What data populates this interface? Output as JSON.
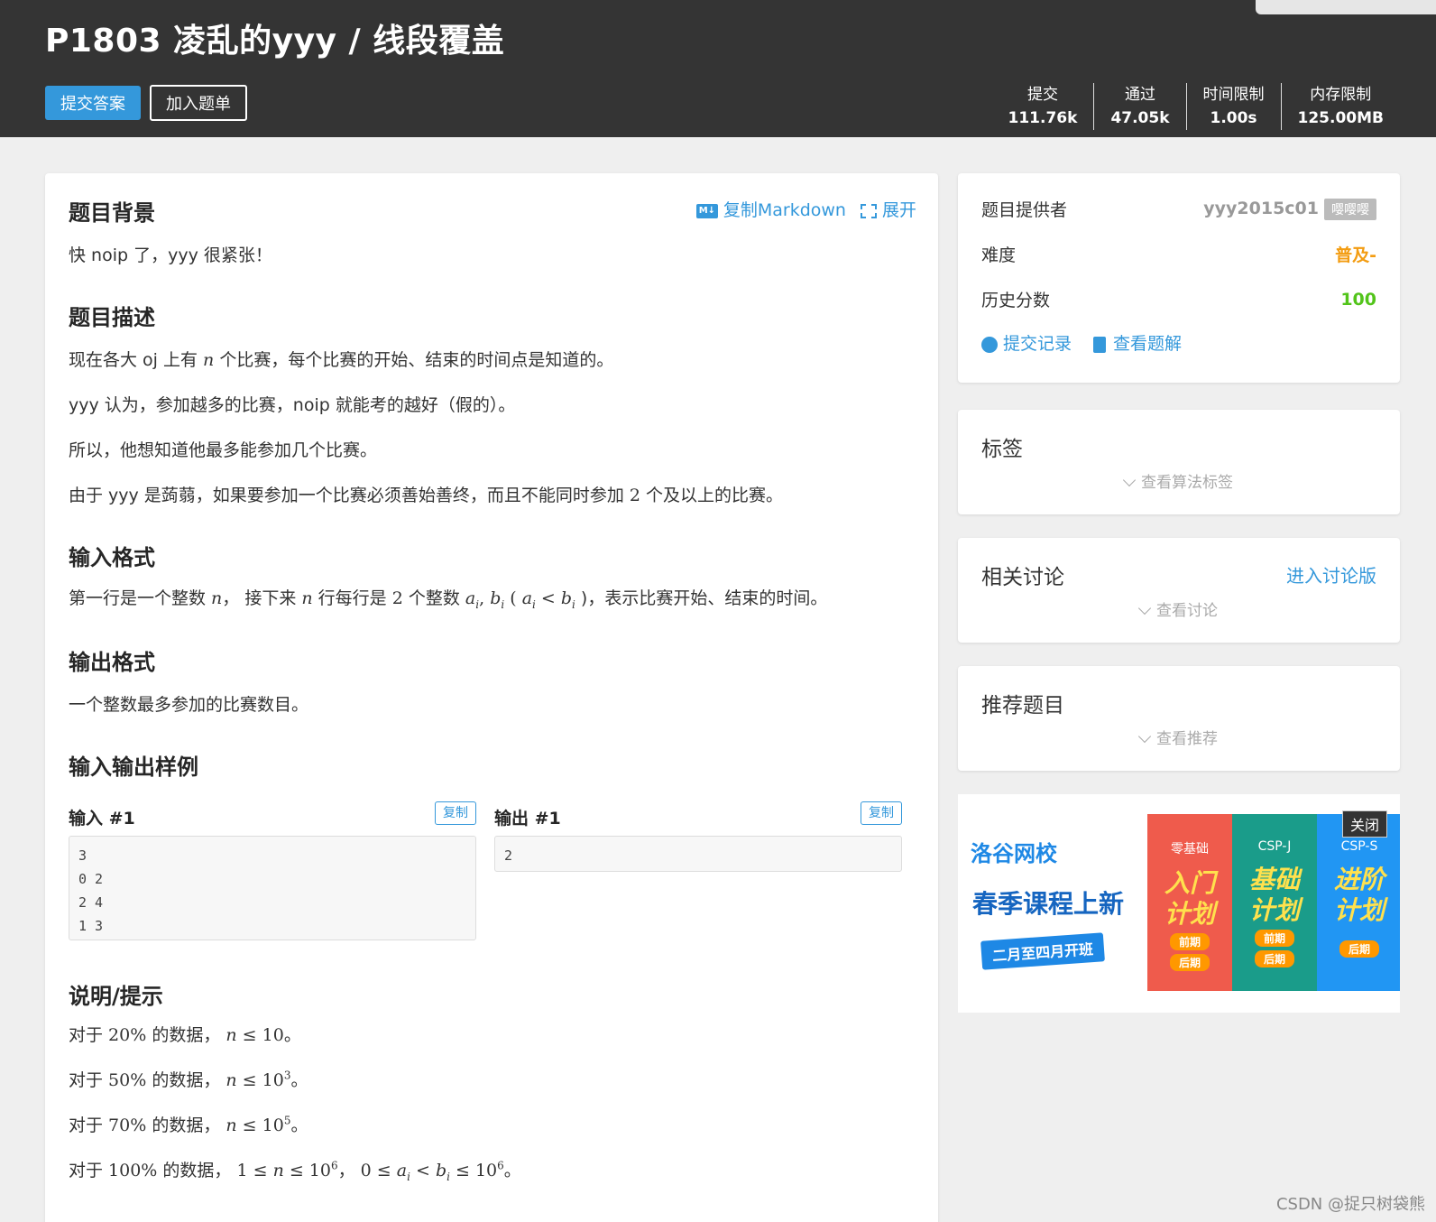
{
  "header": {
    "title": "P1803 凌乱的yyy / 线段覆盖",
    "submit_label": "提交答案",
    "add_label": "加入题单",
    "stats": [
      {
        "label": "提交",
        "value": "111.76k"
      },
      {
        "label": "通过",
        "value": "47.05k"
      },
      {
        "label": "时间限制",
        "value": "1.00s"
      },
      {
        "label": "内存限制",
        "value": "125.00MB"
      }
    ]
  },
  "main": {
    "tools": {
      "md_icon": "M↓",
      "copy_md": "复制Markdown",
      "expand": "展开"
    },
    "background": {
      "title": "题目背景",
      "text": "快 noip 了，yyy 很紧张！"
    },
    "description": {
      "title": "题目描述",
      "p1_a": "现在各大 oj 上有 ",
      "p1_var": "n",
      "p1_b": " 个比赛，每个比赛的开始、结束的时间点是知道的。",
      "p2": "yyy 认为，参加越多的比赛，noip 就能考的越好（假的）。",
      "p3": "所以，他想知道他最多能参加几个比赛。",
      "p4_a": "由于 yyy 是蒟蒻，如果要参加一个比赛必须善始善终，而且不能同时参加 ",
      "p4_num": "2",
      "p4_b": " 个及以上的比赛。"
    },
    "input_format": {
      "title": "输入格式",
      "a": "第一行是一个整数 ",
      "n1": "n",
      "b": "， 接下来 ",
      "n2": "n",
      "c": " 行每行是 ",
      "two": "2",
      "d": " 个整数 ",
      "ai": "a",
      "i": "i",
      "comma": ", ",
      "bi": "b",
      "e": " ( ",
      "lt": " < ",
      "f": " )，表示比赛开始、结束的时间。"
    },
    "output_format": {
      "title": "输出格式",
      "text": "一个整数最多参加的比赛数目。"
    },
    "samples": {
      "title": "输入输出样例",
      "input_label": "输入 #1",
      "output_label": "输出 #1",
      "copy_label": "复制",
      "input": "3\n0 2\n2 4\n1 3",
      "output": "2"
    },
    "hint": {
      "title": "说明/提示",
      "lines": [
        {
          "a": "对于 ",
          "pct": "20%",
          "b": " 的数据，",
          "cond_var": "n",
          "cond": " ≤ 10",
          "sup": "",
          "end": "。"
        },
        {
          "a": "对于 ",
          "pct": "50%",
          "b": " 的数据，",
          "cond_var": "n",
          "cond": " ≤ 10",
          "sup": "3",
          "end": "。"
        },
        {
          "a": "对于 ",
          "pct": "70%",
          "b": " 的数据，",
          "cond_var": "n",
          "cond": " ≤ 10",
          "sup": "5",
          "end": "。"
        }
      ],
      "last": {
        "a": "对于 ",
        "pct": "100%",
        "b": " 的数据， ",
        "c1": "1 ≤ ",
        "n": "n",
        "c2": " ≤ 10",
        "sup1": "6",
        "c3": "，  0 ≤ ",
        "c4": " < ",
        "c5": " ≤ 10",
        "sup2": "6",
        "end": "。"
      }
    }
  },
  "info": {
    "provider_label": "题目提供者",
    "provider_name": "yyy2015c01",
    "provider_badge": "嘤嘤嘤",
    "difficulty_label": "难度",
    "difficulty_value": "普及-",
    "score_label": "历史分数",
    "score_value": "100",
    "records_link": "提交记录",
    "solutions_link": "查看题解"
  },
  "tags_card": {
    "title": "标签",
    "more": "查看算法标签"
  },
  "discuss_card": {
    "title": "相关讨论",
    "link": "进入讨论版",
    "more": "查看讨论"
  },
  "recommend_card": {
    "title": "推荐题目",
    "more": "查看推荐"
  },
  "ad": {
    "logo": "洛谷网校",
    "slogan": "春季课程上新",
    "ribbon": "二月至四月开班",
    "close": "关闭",
    "columns": [
      {
        "tag": "零基础",
        "big1": "入门",
        "big2": "计划",
        "pill1": "前期",
        "pill2": "后期",
        "color": "#ef5b4c"
      },
      {
        "tag": "CSP-J",
        "big1": "基础",
        "big2": "计划",
        "pill1": "前期",
        "pill2": "后期",
        "color": "#1a9c8a"
      },
      {
        "tag": "CSP-S",
        "big1": "进阶",
        "big2": "计划",
        "pill1": "后期",
        "pill2": "",
        "color": "#2196f3"
      }
    ]
  },
  "watermark": "CSDN @捉只树袋熊"
}
